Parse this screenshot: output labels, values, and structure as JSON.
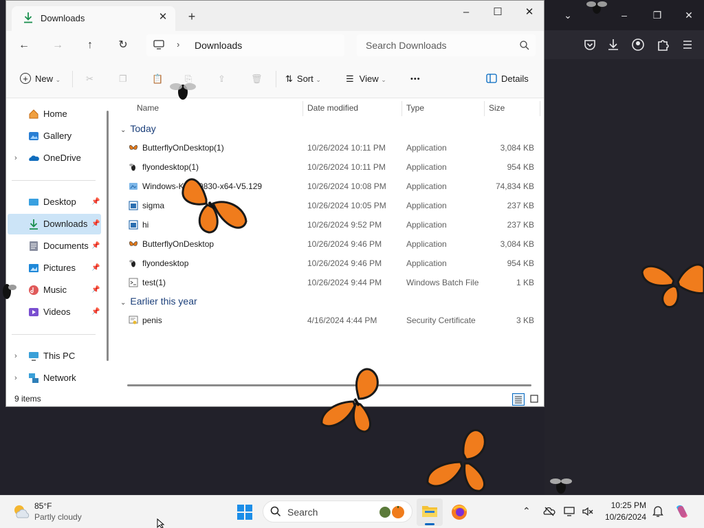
{
  "explorer": {
    "tab_title": "Downloads",
    "new_tab": "+",
    "window_controls": {
      "minimize": "–",
      "maximize": "☐",
      "close": "✕"
    },
    "address": {
      "separator": "›",
      "path": "Downloads"
    },
    "search_placeholder": "Search Downloads",
    "toolbar": {
      "new": "New",
      "sort": "Sort",
      "view": "View",
      "more": "•••",
      "details": "Details"
    },
    "sidebar": {
      "top": [
        {
          "label": "Home",
          "icon": "home-icon"
        },
        {
          "label": "Gallery",
          "icon": "gallery-icon"
        },
        {
          "label": "OneDrive",
          "icon": "onedrive-icon",
          "expandable": true
        }
      ],
      "quick": [
        {
          "label": "Desktop",
          "icon": "desktop-icon",
          "pinned": true
        },
        {
          "label": "Downloads",
          "icon": "downloads-icon",
          "pinned": true,
          "selected": true
        },
        {
          "label": "Documents",
          "icon": "documents-icon",
          "pinned": true
        },
        {
          "label": "Pictures",
          "icon": "pictures-icon",
          "pinned": true
        },
        {
          "label": "Music",
          "icon": "music-icon",
          "pinned": true
        },
        {
          "label": "Videos",
          "icon": "videos-icon",
          "pinned": true
        }
      ],
      "bottom": [
        {
          "label": "This PC",
          "icon": "this-pc-icon",
          "expandable": true
        },
        {
          "label": "Network",
          "icon": "network-icon",
          "expandable": true
        }
      ]
    },
    "columns": {
      "name": "Name",
      "date": "Date modified",
      "type": "Type",
      "size": "Size"
    },
    "groups": [
      {
        "label": "Today",
        "files": [
          {
            "name": "ButterflyOnDesktop(1)",
            "date": "10/26/2024 10:11 PM",
            "type": "Application",
            "size": "3,084 KB",
            "icon": "butterfly-app-icon"
          },
          {
            "name": "flyondesktop(1)",
            "date": "10/26/2024 10:11 PM",
            "type": "Application",
            "size": "954 KB",
            "icon": "fly-app-icon"
          },
          {
            "name": "Windows-KB890830-x64-V5.129",
            "date": "10/26/2024 10:08 PM",
            "type": "Application",
            "size": "74,834 KB",
            "icon": "installer-icon"
          },
          {
            "name": "sigma",
            "date": "10/26/2024 10:05 PM",
            "type": "Application",
            "size": "237 KB",
            "icon": "app-window-icon"
          },
          {
            "name": "hi",
            "date": "10/26/2024 9:52 PM",
            "type": "Application",
            "size": "237 KB",
            "icon": "app-window-icon"
          },
          {
            "name": "ButterflyOnDesktop",
            "date": "10/26/2024 9:46 PM",
            "type": "Application",
            "size": "3,084 KB",
            "icon": "butterfly-app-icon"
          },
          {
            "name": "flyondesktop",
            "date": "10/26/2024 9:46 PM",
            "type": "Application",
            "size": "954 KB",
            "icon": "fly-app-icon"
          },
          {
            "name": "test(1)",
            "date": "10/26/2024 9:44 PM",
            "type": "Windows Batch File",
            "size": "1 KB",
            "icon": "batch-file-icon"
          }
        ]
      },
      {
        "label": "Earlier this year",
        "files": [
          {
            "name": "penis",
            "date": "4/16/2024 4:44 PM",
            "type": "Security Certificate",
            "size": "3 KB",
            "icon": "certificate-icon"
          }
        ]
      }
    ],
    "status": "9 items"
  },
  "taskbar": {
    "weather_temp": "85°F",
    "weather_desc": "Partly cloudy",
    "search_label": "Search",
    "time": "10:25 PM",
    "date": "10/26/2024"
  },
  "colors": {
    "accent": "#0067c0",
    "selected": "#cce4f7",
    "butterfly": "#f07c1c"
  }
}
